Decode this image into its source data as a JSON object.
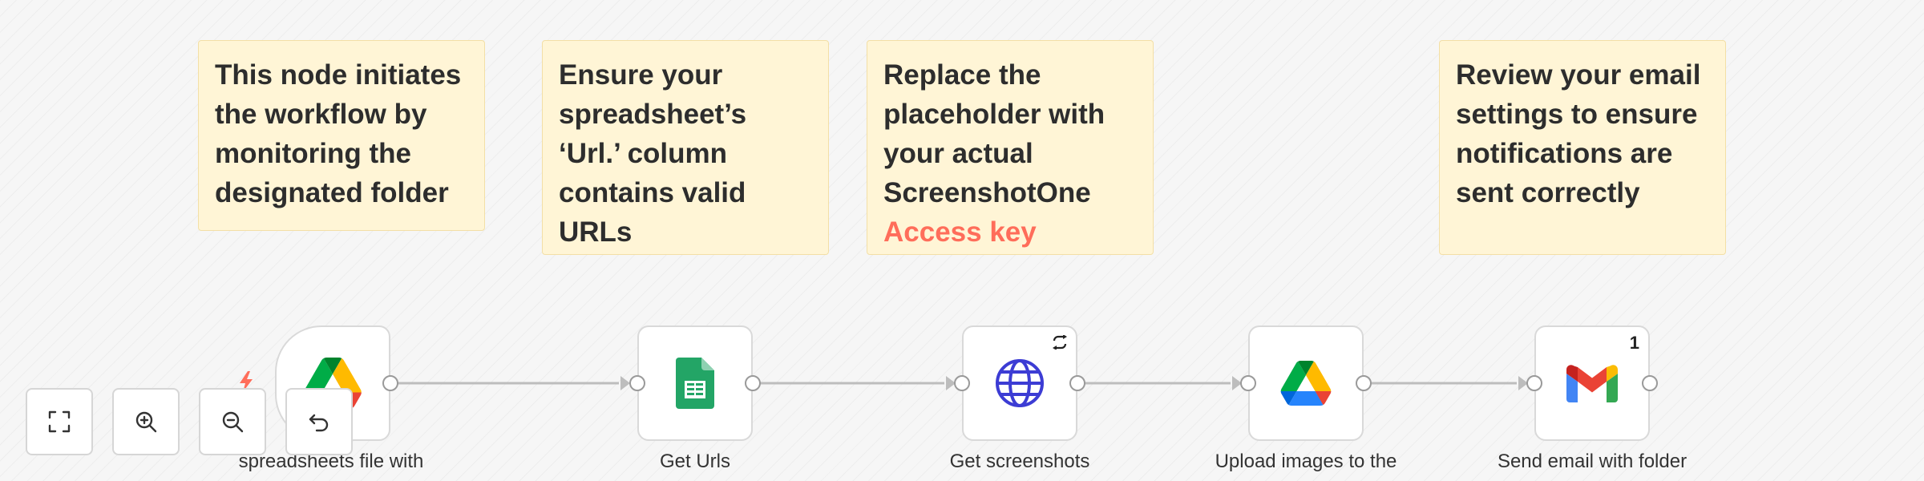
{
  "notes": [
    {
      "text": "This node initiates the workflow by monitoring the designated folder"
    },
    {
      "text": "Ensure your spreadsheet’s ‘Url.’ column contains valid URLs"
    },
    {
      "text": "Replace the placeholder with your actual ScreenshotOne",
      "accent": "Access key"
    },
    {
      "text": "Review your email settings to ensure notifications are sent correctly"
    }
  ],
  "nodes": [
    {
      "label": "spreadsheets file with",
      "icon": "google-drive-icon"
    },
    {
      "label": "Get Urls",
      "icon": "google-sheets-icon"
    },
    {
      "label": "Get screenshots",
      "icon": "globe-icon"
    },
    {
      "label": "Upload images to the",
      "icon": "google-drive-icon"
    },
    {
      "label": "Send email with folder",
      "icon": "gmail-icon",
      "badge": "1"
    }
  ],
  "controls": [
    {
      "name": "fit-view",
      "icon": "fullscreen-icon"
    },
    {
      "name": "zoom-in",
      "icon": "zoom-in-icon"
    },
    {
      "name": "zoom-out",
      "icon": "zoom-out-icon"
    },
    {
      "name": "reset-zoom",
      "icon": "undo-icon"
    }
  ],
  "colors": {
    "canvas": "#f6f6f6",
    "note_background": "#fff5d6",
    "note_accent": "#ff6d5a",
    "trigger_bolt": "#ff6d5a",
    "connector": "#bdbdbd"
  }
}
